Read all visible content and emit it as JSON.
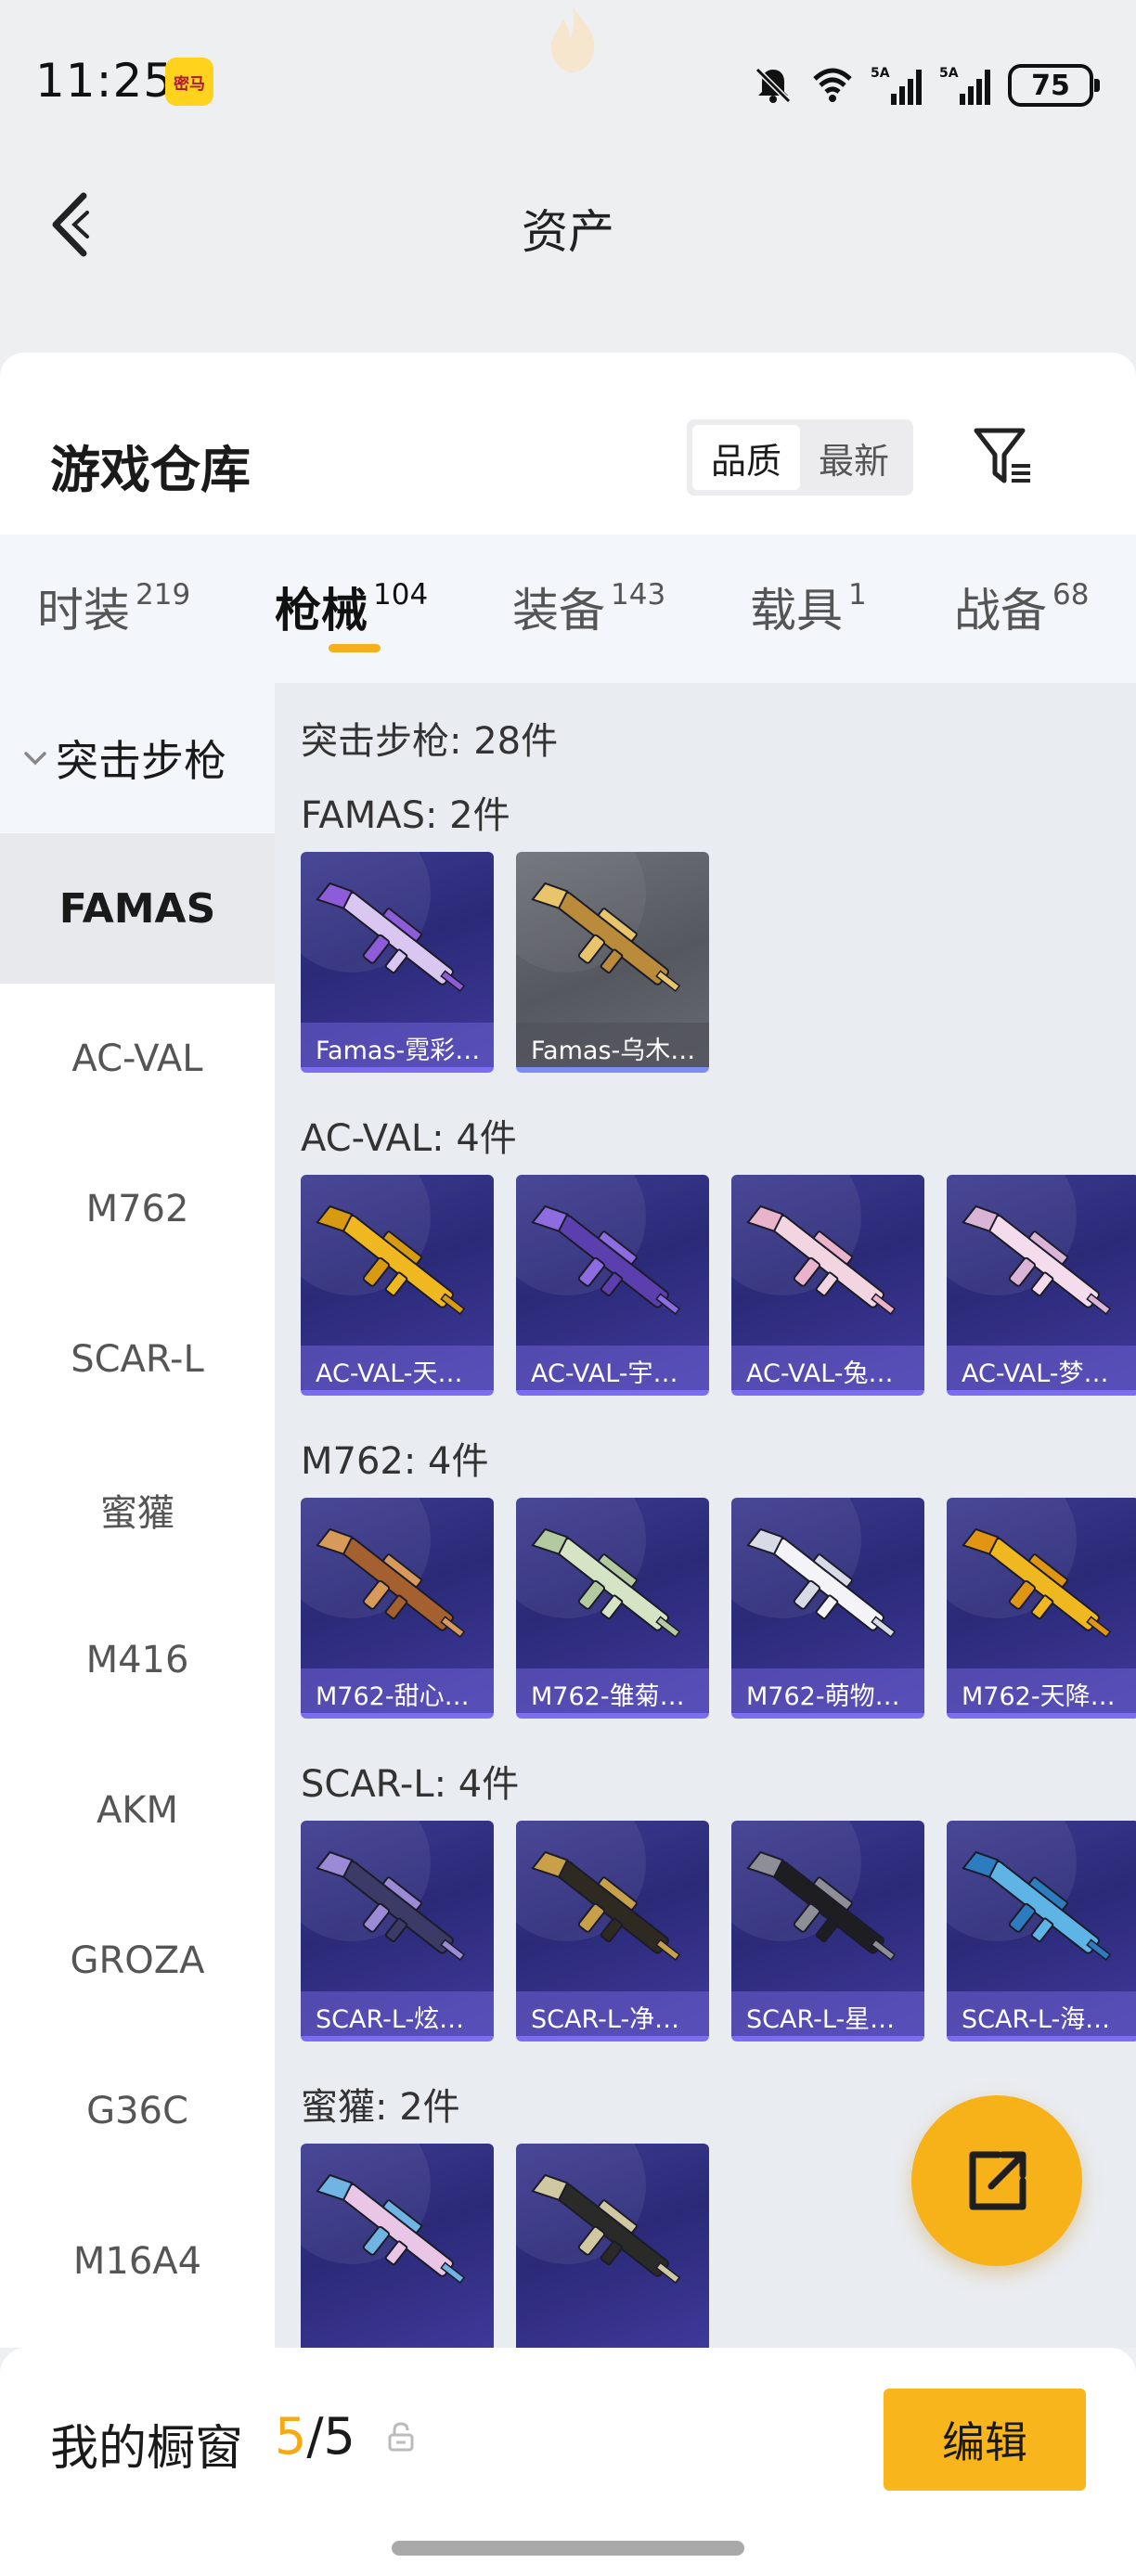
{
  "status_bar": {
    "time": "11:25",
    "app_badge": "密马",
    "battery": "75"
  },
  "nav": {
    "title": "资产"
  },
  "warehouse": {
    "title": "游戏仓库",
    "sort_options": [
      "品质",
      "最新"
    ],
    "active_sort": "品质"
  },
  "tabs": [
    {
      "label": "时装",
      "count": "219"
    },
    {
      "label": "枪械",
      "count": "104"
    },
    {
      "label": "装备",
      "count": "143"
    },
    {
      "label": "载具",
      "count": "1"
    },
    {
      "label": "战备",
      "count": "68"
    }
  ],
  "active_tab": "枪械",
  "sidebar": {
    "group": "突击步枪",
    "items": [
      "FAMAS",
      "AC-VAL",
      "M762",
      "SCAR-L",
      "蜜獾",
      "M416",
      "AKM",
      "GROZA",
      "G36C",
      "M16A4"
    ],
    "active_item": "FAMAS"
  },
  "content": {
    "total": "突击步枪: 28件",
    "sections": [
      {
        "label": "FAMAS: 2件",
        "items": [
          "Famas-霓彩…",
          "Famas-乌木…"
        ]
      },
      {
        "label": "AC-VAL: 4件",
        "items": [
          "AC-VAL-天…",
          "AC-VAL-宇…",
          "AC-VAL-兔…",
          "AC-VAL-梦…"
        ]
      },
      {
        "label": "M762: 4件",
        "items": [
          "M762-甜心…",
          "M762-雏菊…",
          "M762-萌物…",
          "M762-天降…"
        ]
      },
      {
        "label": "SCAR-L: 4件",
        "items": [
          "SCAR-L-炫…",
          "SCAR-L-净…",
          "SCAR-L-星…",
          "SCAR-L-海…"
        ]
      },
      {
        "label": "蜜獾: 2件",
        "items": [
          "",
          ""
        ]
      }
    ]
  },
  "bottom_bar": {
    "title": "我的橱窗",
    "current": "5",
    "total": "/5",
    "edit_label": "编辑"
  },
  "colors": {
    "accent": "#f8b61c",
    "card_bg": "#2b2a78",
    "card_grey": "#55585f",
    "page_bg": "#eeeff1"
  }
}
